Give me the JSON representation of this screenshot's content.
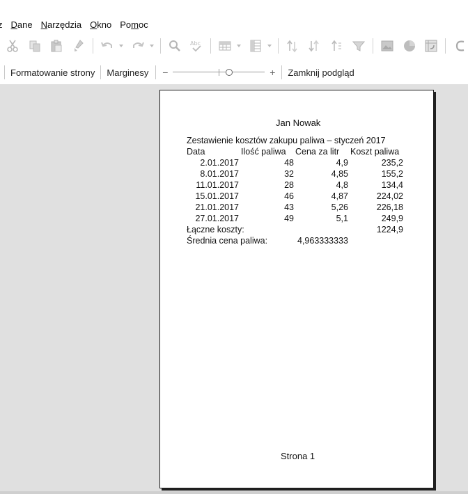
{
  "menu": {
    "items": [
      {
        "name": "menu-partial-z",
        "label": "z"
      },
      {
        "name": "menu-dane",
        "label": "Dane"
      },
      {
        "name": "menu-narzedzia",
        "label": "Narzędzia"
      },
      {
        "name": "menu-okno",
        "label": "Okno"
      },
      {
        "name": "menu-pomoc",
        "label": "Pomoc"
      }
    ]
  },
  "toolbar": {
    "icons": [
      "cut-icon",
      "copy-icon",
      "paste-icon",
      "clone-formatting-icon",
      "undo-icon",
      "redo-icon",
      "find-replace-icon",
      "spellcheck-icon",
      "row-icon",
      "column-icon",
      "sort-ascending-icon",
      "sort-descending-icon",
      "sort-icon",
      "autofilter-icon",
      "image-icon",
      "chart-icon",
      "pivot-table-icon",
      "special-character-icon"
    ]
  },
  "preview": {
    "format_page": "Formatowanie strony",
    "margins": "Marginesy",
    "zoom_minus": "−",
    "zoom_plus": "+",
    "zoom_level": 0.62,
    "close_preview": "Zamknij podgląd"
  },
  "page": {
    "header": "Jan Nowak",
    "title": "Zestawienie kosztów zakupu paliwa – styczeń 2017",
    "columns": [
      "Data",
      "Ilość paliwa",
      "Cena za litr",
      "Koszt paliwa"
    ],
    "rows": [
      [
        "2.01.2017",
        "48",
        "4,9",
        "235,2"
      ],
      [
        "8.01.2017",
        "32",
        "4,85",
        "155,2"
      ],
      [
        "11.01.2017",
        "28",
        "4,8",
        "134,4"
      ],
      [
        "15.01.2017",
        "46",
        "4,87",
        "224,02"
      ],
      [
        "21.01.2017",
        "43",
        "5,26",
        "226,18"
      ],
      [
        "27.01.2017",
        "49",
        "5,1",
        "249,9"
      ]
    ],
    "total_label": "Łączne koszty:",
    "total_value": "1224,9",
    "avg_label": "Średnia cena paliwa:",
    "avg_value": "4,963333333",
    "footer": "Strona 1"
  }
}
